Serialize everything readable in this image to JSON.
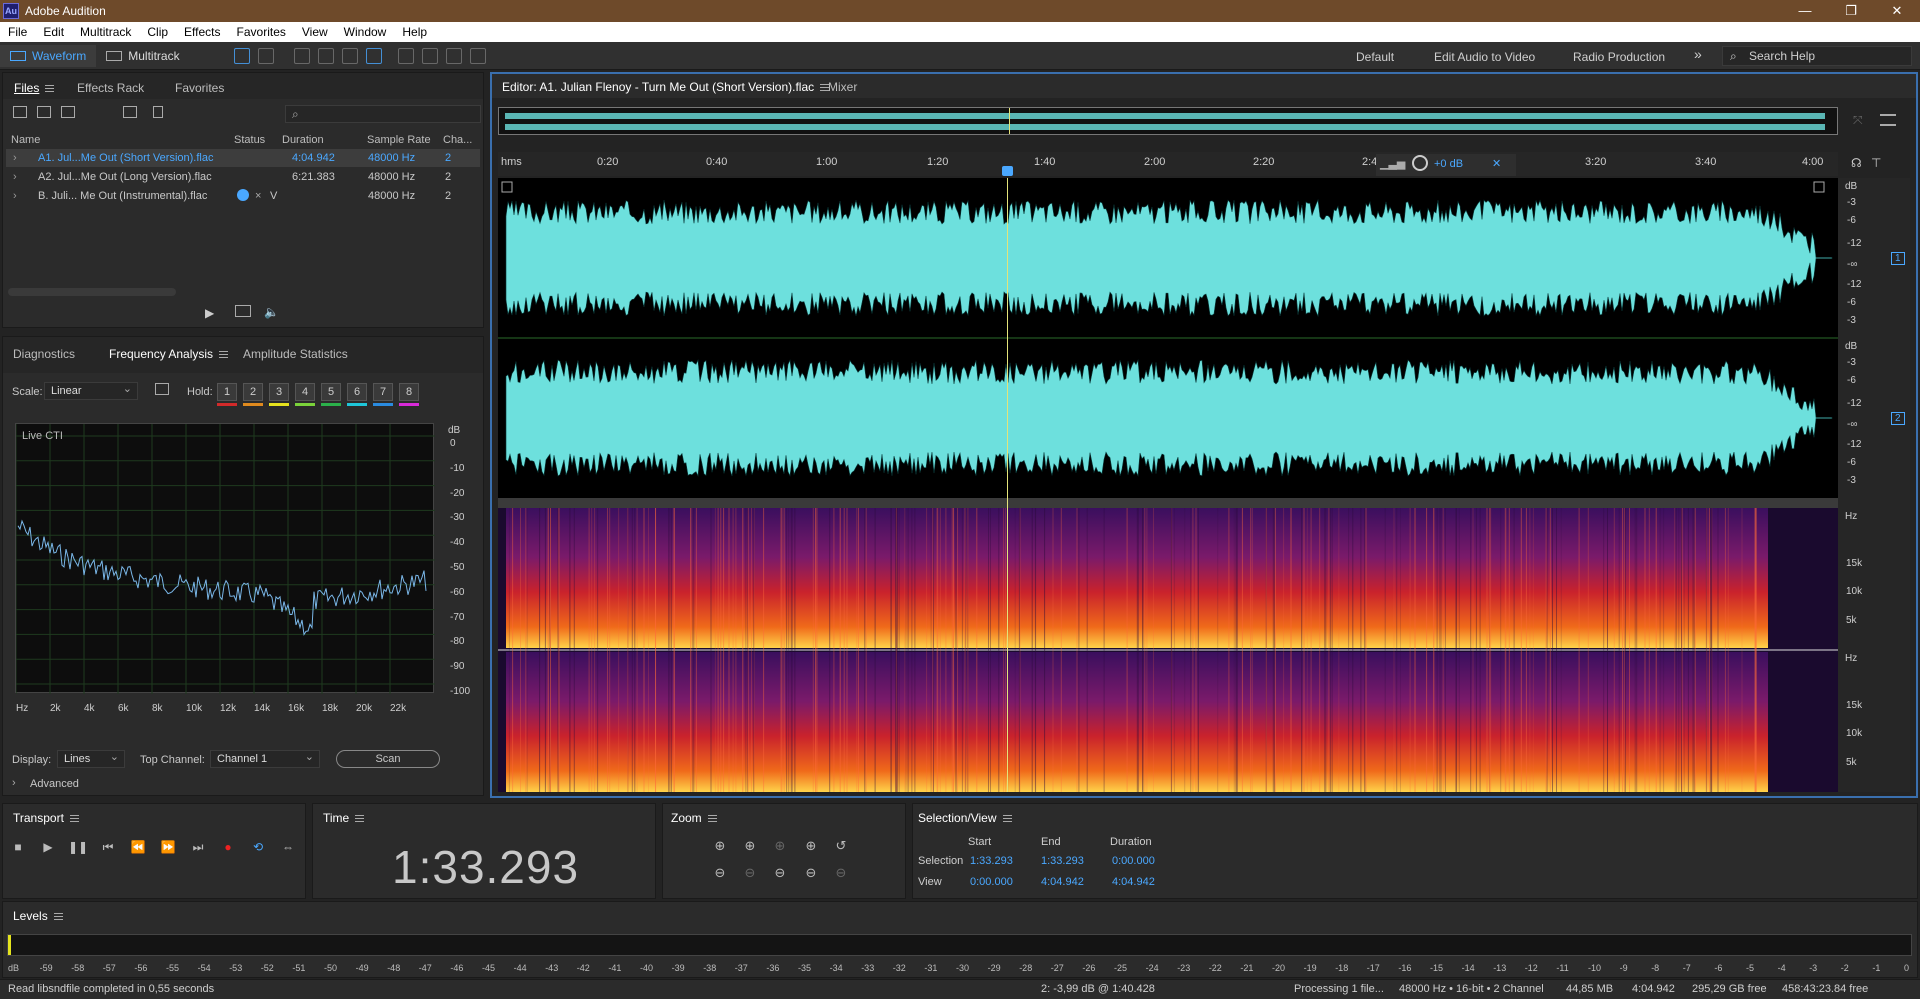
{
  "app": {
    "title": "Adobe Audition",
    "logo": "Au"
  },
  "menu": [
    "File",
    "Edit",
    "Multitrack",
    "Clip",
    "Effects",
    "Favorites",
    "View",
    "Window",
    "Help"
  ],
  "toolbar": {
    "waveform": "Waveform",
    "multitrack": "Multitrack"
  },
  "workspaces": [
    "Default",
    "Edit Audio to Video",
    "Radio Production"
  ],
  "search_help": "Search Help",
  "files_panel": {
    "tabs": [
      "Files",
      "Effects Rack",
      "Favorites"
    ],
    "columns": [
      "Name",
      "Status",
      "Duration",
      "Sample Rate",
      "Cha..."
    ],
    "rows": [
      {
        "name": "A1. Jul...Me Out (Short Version).flac",
        "duration": "4:04.942",
        "rate": "48000 Hz",
        "ch": "2",
        "selected": true
      },
      {
        "name": "A2. Jul...Me Out (Long Version).flac",
        "duration": "6:21.383",
        "rate": "48000 Hz",
        "ch": "2",
        "selected": false
      },
      {
        "name": "B. Juli... Me Out (Instrumental).flac",
        "status": "V",
        "duration": "",
        "rate": "48000 Hz",
        "ch": "2",
        "selected": false
      }
    ]
  },
  "analysis_panel": {
    "tabs": [
      "Diagnostics",
      "Frequency Analysis",
      "Amplitude Statistics"
    ],
    "scale_label": "Scale:",
    "scale_value": "Linear",
    "hold_label": "Hold:",
    "hold_buttons": [
      "1",
      "2",
      "3",
      "4",
      "5",
      "6",
      "7",
      "8"
    ],
    "hold_colors": [
      "#d32a2a",
      "#e08a1e",
      "#e6e21e",
      "#7bd33a",
      "#2bb04a",
      "#1ec6d9",
      "#2a8be0",
      "#d92ad9"
    ],
    "graph_label": "Live CTI",
    "db_unit": "dB",
    "db_ticks": [
      "0",
      "-10",
      "-20",
      "-30",
      "-40",
      "-50",
      "-60",
      "-70",
      "-80",
      "-90",
      "-100"
    ],
    "hz_ticks": [
      "Hz",
      "2k",
      "4k",
      "6k",
      "8k",
      "10k",
      "12k",
      "14k",
      "16k",
      "18k",
      "20k",
      "22k"
    ],
    "display_label": "Display:",
    "display_value": "Lines",
    "top_channel_label": "Top Channel:",
    "top_channel_value": "Channel 1",
    "scan_label": "Scan",
    "advanced_label": "Advanced"
  },
  "editor": {
    "tab": "Editor: A1. Julian Flenoy - Turn Me Out (Short Version).flac",
    "mixer": "Mixer",
    "ruler_unit": "hms",
    "ruler": [
      "0:20",
      "0:40",
      "1:00",
      "1:20",
      "1:40",
      "2:00",
      "2:20",
      "2:4",
      "3:20",
      "3:40",
      "4:00"
    ],
    "gain": "+0 dB",
    "db_unit": "dB",
    "db_scale": [
      "-3",
      "-6",
      "-12",
      "-∞",
      "-12",
      "-6",
      "-3"
    ],
    "channels": [
      "1",
      "2"
    ],
    "spec_unit": "Hz",
    "spec_scale": [
      "15k",
      "10k",
      "5k"
    ],
    "wave_color": "#6de0dd"
  },
  "transport": {
    "title": "Transport"
  },
  "time": {
    "title": "Time",
    "value": "1:33.293"
  },
  "zoom": {
    "title": "Zoom"
  },
  "selection_view": {
    "title": "Selection/View",
    "headers": [
      "Start",
      "End",
      "Duration"
    ],
    "selection_label": "Selection",
    "view_label": "View",
    "selection": [
      "1:33.293",
      "1:33.293",
      "0:00.000"
    ],
    "view": [
      "0:00.000",
      "4:04.942",
      "4:04.942"
    ]
  },
  "levels": {
    "title": "Levels",
    "scale": [
      "dB",
      "-59",
      "-58",
      "-57",
      "-56",
      "-55",
      "-54",
      "-53",
      "-52",
      "-51",
      "-50",
      "-49",
      "-48",
      "-47",
      "-46",
      "-45",
      "-44",
      "-43",
      "-42",
      "-41",
      "-40",
      "-39",
      "-38",
      "-37",
      "-36",
      "-35",
      "-34",
      "-33",
      "-32",
      "-31",
      "-30",
      "-29",
      "-28",
      "-27",
      "-26",
      "-25",
      "-24",
      "-23",
      "-22",
      "-21",
      "-20",
      "-19",
      "-18",
      "-17",
      "-16",
      "-15",
      "-14",
      "-13",
      "-12",
      "-11",
      "-10",
      "-9",
      "-8",
      "-7",
      "-6",
      "-5",
      "-4",
      "-3",
      "-2",
      "-1",
      "0"
    ]
  },
  "status": {
    "message": "Read libsndfile completed in 0,55 seconds",
    "cursor": "2: -3,99 dB @ 1:40.428",
    "processing": "Processing 1 file...",
    "format": "48000 Hz • 16-bit • 2 Channel",
    "size": "44,85 MB",
    "duration": "4:04.942",
    "free": "295,29 GB free",
    "time_free": "458:43:23.84 free"
  }
}
